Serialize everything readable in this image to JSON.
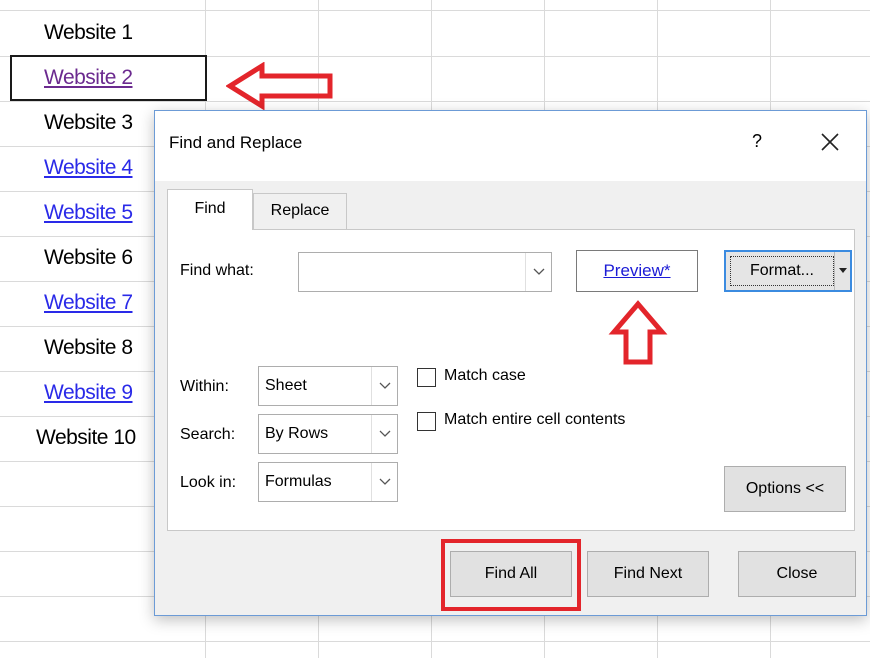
{
  "sheet": {
    "cells": [
      {
        "text": "Website 1",
        "style": "plain"
      },
      {
        "text": "Website 2",
        "style": "visited"
      },
      {
        "text": "Website 3",
        "style": "plain"
      },
      {
        "text": "Website 4",
        "style": "link"
      },
      {
        "text": "Website 5",
        "style": "link"
      },
      {
        "text": "Website 6",
        "style": "plain"
      },
      {
        "text": "Website 7",
        "style": "link"
      },
      {
        "text": "Website 8",
        "style": "plain"
      },
      {
        "text": "Website 9",
        "style": "link"
      },
      {
        "text": "Website 10",
        "style": "plain"
      }
    ]
  },
  "dialog": {
    "title": "Find and Replace",
    "help": "?",
    "tabs": [
      {
        "label": "Find",
        "active": true
      },
      {
        "label": "Replace",
        "active": false
      }
    ],
    "find_what": {
      "label": "Find what:",
      "value": ""
    },
    "preview": "Preview*",
    "format_button": "Format...",
    "within": {
      "label": "Within:",
      "value": "Sheet"
    },
    "search": {
      "label": "Search:",
      "value": "By Rows"
    },
    "look_in": {
      "label": "Look in:",
      "value": "Formulas"
    },
    "match_case": {
      "label": "Match case",
      "checked": false
    },
    "match_entire": {
      "label": "Match entire cell contents",
      "checked": false
    },
    "options_button": "Options <<",
    "buttons": {
      "find_all": "Find All",
      "find_next": "Find Next",
      "close": "Close"
    }
  },
  "colors": {
    "annotation": "#e3252b",
    "link": "#2a2ae8",
    "visited": "#6b2a8f",
    "dialog_border": "#6c9bd6"
  }
}
